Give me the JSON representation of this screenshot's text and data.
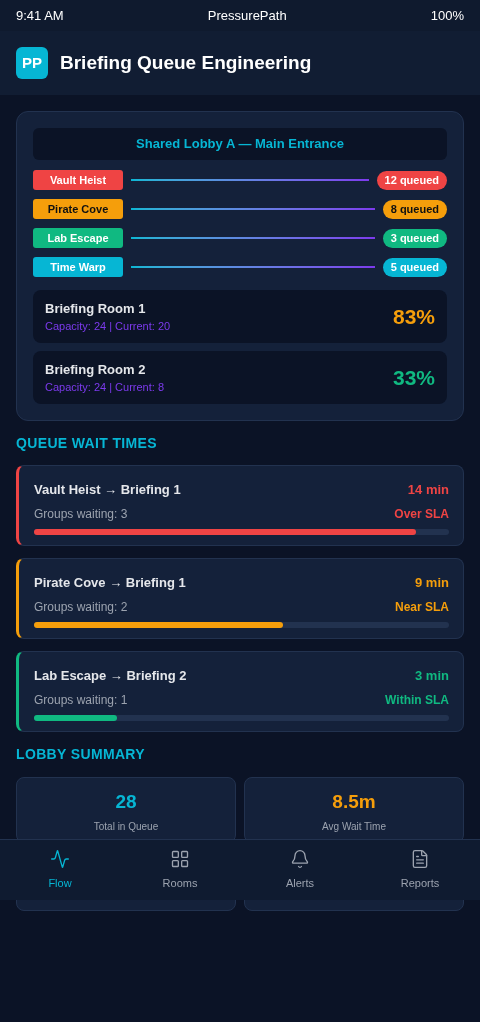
{
  "status_bar": {
    "time": "9:41 AM",
    "carrier": "PressurePath",
    "battery": "100%"
  },
  "header": {
    "logo": "PP",
    "title": "Briefing Queue Engineering"
  },
  "lobby": {
    "title": "Shared Lobby A — Main Entrance",
    "queues": [
      {
        "name": "Vault Heist",
        "count": "12 queued",
        "color": "#ef4444"
      },
      {
        "name": "Pirate Cove",
        "count": "8 queued",
        "color": "#f59e0b"
      },
      {
        "name": "Lab Escape",
        "count": "3 queued",
        "color": "#10b981"
      },
      {
        "name": "Time Warp",
        "count": "5 queued",
        "color": "#06b6d4"
      }
    ],
    "rooms": [
      {
        "name": "Briefing Room 1",
        "detail": "Capacity: 24 | Current: 20",
        "percent": "83%",
        "color": "#f59e0b"
      },
      {
        "name": "Briefing Room 2",
        "detail": "Capacity: 24 | Current: 8",
        "percent": "33%",
        "color": "#10b981"
      }
    ]
  },
  "wait_times": {
    "title": "QUEUE WAIT TIMES",
    "items": [
      {
        "route": "Vault Heist → Briefing 1",
        "groups": "Groups waiting: 3",
        "time": "14 min",
        "status": "Over SLA",
        "level": 0.92,
        "color": "#ef4444"
      },
      {
        "route": "Pirate Cove → Briefing 1",
        "groups": "Groups waiting: 2",
        "time": "9 min",
        "status": "Near SLA",
        "level": 0.6,
        "color": "#f59e0b"
      },
      {
        "route": "Lab Escape → Briefing 2",
        "groups": "Groups waiting: 1",
        "time": "3 min",
        "status": "Within SLA",
        "level": 0.2,
        "color": "#10b981"
      }
    ]
  },
  "summary": {
    "title": "LOBBY SUMMARY",
    "cards": [
      {
        "value": "28",
        "label": "Total in Queue",
        "color": "#06b6d4"
      },
      {
        "value": "8.5m",
        "label": "Avg Wait Time",
        "color": "#f59e0b"
      }
    ]
  },
  "nav": [
    {
      "label": "Flow",
      "selected": true
    },
    {
      "label": "Rooms",
      "selected": false
    },
    {
      "label": "Alerts",
      "selected": false
    },
    {
      "label": "Reports",
      "selected": false
    }
  ]
}
